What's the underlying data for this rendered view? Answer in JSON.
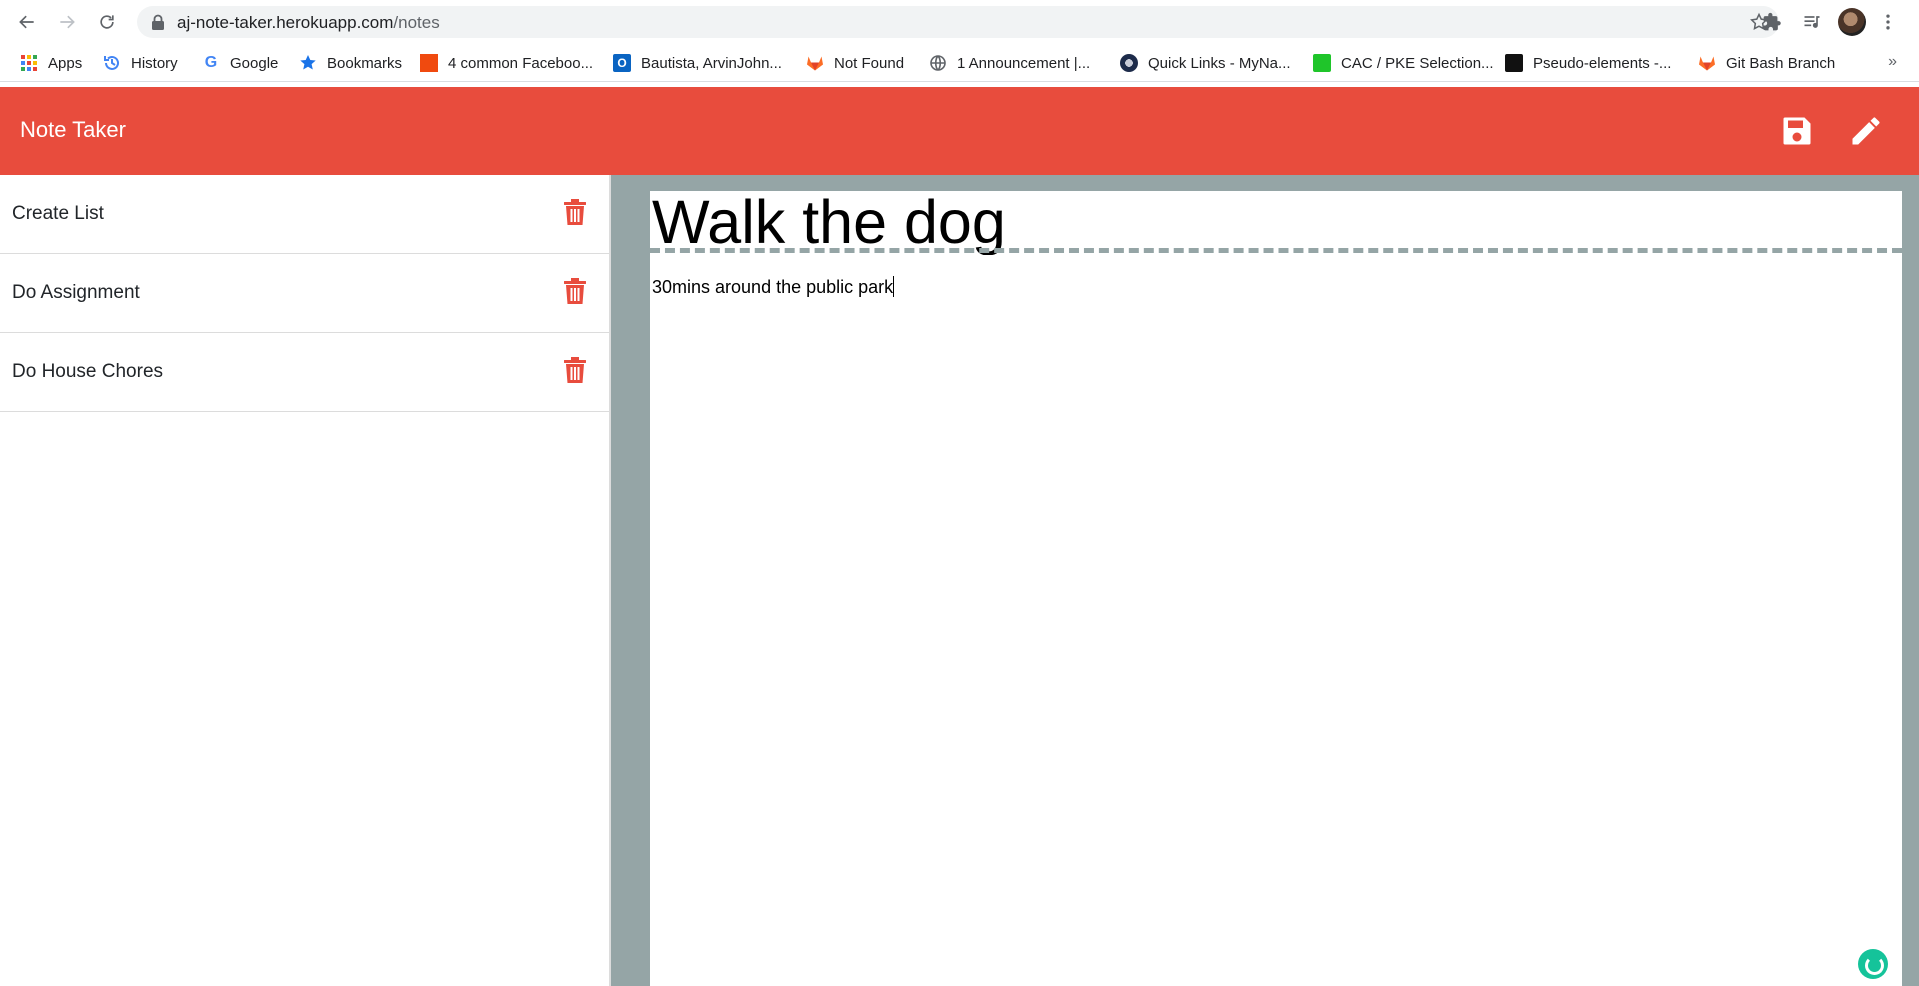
{
  "browser": {
    "url_host": "aj-note-taker.herokuapp.com",
    "url_path": "/notes",
    "bookmarks": [
      {
        "label": "Apps",
        "icon": "apps-grid-icon"
      },
      {
        "label": "History",
        "icon": "history-icon"
      },
      {
        "label": "Google",
        "icon": "google-icon"
      },
      {
        "label": "Bookmarks",
        "icon": "star-icon"
      },
      {
        "label": "4 common Faceboo...",
        "icon": "orange-square-icon"
      },
      {
        "label": "Bautista, ArvinJohn...",
        "icon": "outlook-icon"
      },
      {
        "label": "Not Found",
        "icon": "gitlab-icon"
      },
      {
        "label": "1 Announcement |...",
        "icon": "globe-icon"
      },
      {
        "label": "Quick Links - MyNa...",
        "icon": "navy-seal-icon"
      },
      {
        "label": "CAC / PKE Selection...",
        "icon": "cac-icon"
      },
      {
        "label": "Pseudo-elements -...",
        "icon": "dark-logo-icon"
      },
      {
        "label": "Git Bash Branch",
        "icon": "gitlab-icon"
      }
    ],
    "more_label": "»"
  },
  "app": {
    "title": "Note Taker",
    "accent_color": "#e84c3d",
    "editor_bg_color": "#95a5a6"
  },
  "notes": [
    {
      "label": "Create List"
    },
    {
      "label": "Do Assignment"
    },
    {
      "label": "Do House Chores"
    }
  ],
  "active_note": {
    "title": "Walk the dog",
    "text": "30mins around the public park"
  }
}
